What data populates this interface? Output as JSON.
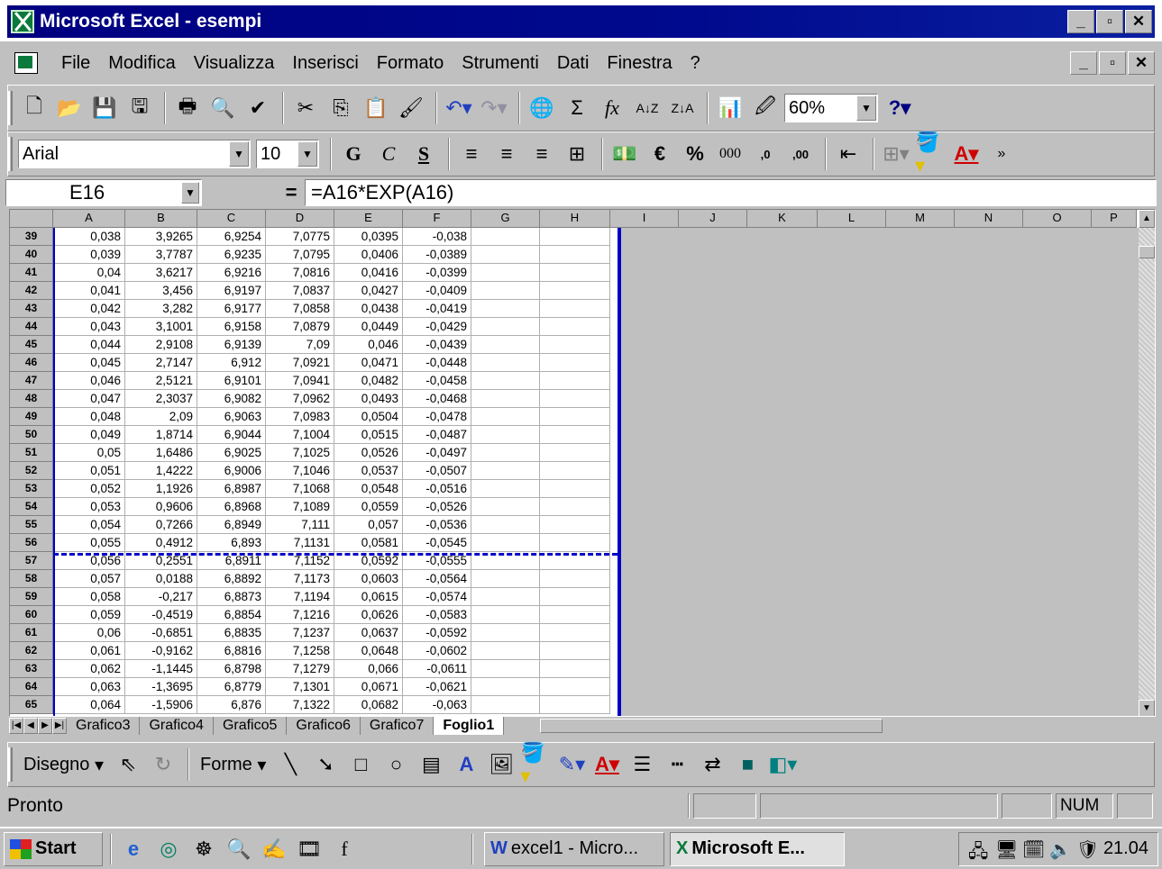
{
  "window": {
    "title": "Microsoft Excel - esempi"
  },
  "menu": [
    "File",
    "Modifica",
    "Visualizza",
    "Inserisci",
    "Formato",
    "Strumenti",
    "Dati",
    "Finestra",
    "?"
  ],
  "standard_toolbar": {
    "zoom": "60%"
  },
  "format_toolbar": {
    "font": "Arial",
    "size": "10",
    "bold": "G",
    "italic": "C",
    "underline": "S",
    "euro": "€",
    "percent": "%",
    "thousands": "000",
    "inc_decimals": ",0",
    "dec_decimals": ",00"
  },
  "formula_bar": {
    "cell_ref": "E16",
    "eq": "=",
    "formula": "=A16*EXP(A16)"
  },
  "columns": [
    "A",
    "B",
    "C",
    "D",
    "E",
    "F",
    "G",
    "H",
    "I",
    "J",
    "K",
    "L",
    "M",
    "N",
    "O",
    "P"
  ],
  "rows": [
    {
      "n": "39",
      "a": "0,038",
      "b": "3,9265",
      "c": "6,9254",
      "d": "7,0775",
      "e": "0,0395",
      "f": "-0,038"
    },
    {
      "n": "40",
      "a": "0,039",
      "b": "3,7787",
      "c": "6,9235",
      "d": "7,0795",
      "e": "0,0406",
      "f": "-0,0389"
    },
    {
      "n": "41",
      "a": "0,04",
      "b": "3,6217",
      "c": "6,9216",
      "d": "7,0816",
      "e": "0,0416",
      "f": "-0,0399"
    },
    {
      "n": "42",
      "a": "0,041",
      "b": "3,456",
      "c": "6,9197",
      "d": "7,0837",
      "e": "0,0427",
      "f": "-0,0409"
    },
    {
      "n": "43",
      "a": "0,042",
      "b": "3,282",
      "c": "6,9177",
      "d": "7,0858",
      "e": "0,0438",
      "f": "-0,0419"
    },
    {
      "n": "44",
      "a": "0,043",
      "b": "3,1001",
      "c": "6,9158",
      "d": "7,0879",
      "e": "0,0449",
      "f": "-0,0429"
    },
    {
      "n": "45",
      "a": "0,044",
      "b": "2,9108",
      "c": "6,9139",
      "d": "7,09",
      "e": "0,046",
      "f": "-0,0439"
    },
    {
      "n": "46",
      "a": "0,045",
      "b": "2,7147",
      "c": "6,912",
      "d": "7,0921",
      "e": "0,0471",
      "f": "-0,0448"
    },
    {
      "n": "47",
      "a": "0,046",
      "b": "2,5121",
      "c": "6,9101",
      "d": "7,0941",
      "e": "0,0482",
      "f": "-0,0458"
    },
    {
      "n": "48",
      "a": "0,047",
      "b": "2,3037",
      "c": "6,9082",
      "d": "7,0962",
      "e": "0,0493",
      "f": "-0,0468"
    },
    {
      "n": "49",
      "a": "0,048",
      "b": "2,09",
      "c": "6,9063",
      "d": "7,0983",
      "e": "0,0504",
      "f": "-0,0478"
    },
    {
      "n": "50",
      "a": "0,049",
      "b": "1,8714",
      "c": "6,9044",
      "d": "7,1004",
      "e": "0,0515",
      "f": "-0,0487"
    },
    {
      "n": "51",
      "a": "0,05",
      "b": "1,6486",
      "c": "6,9025",
      "d": "7,1025",
      "e": "0,0526",
      "f": "-0,0497"
    },
    {
      "n": "52",
      "a": "0,051",
      "b": "1,4222",
      "c": "6,9006",
      "d": "7,1046",
      "e": "0,0537",
      "f": "-0,0507"
    },
    {
      "n": "53",
      "a": "0,052",
      "b": "1,1926",
      "c": "6,8987",
      "d": "7,1068",
      "e": "0,0548",
      "f": "-0,0516"
    },
    {
      "n": "54",
      "a": "0,053",
      "b": "0,9606",
      "c": "6,8968",
      "d": "7,1089",
      "e": "0,0559",
      "f": "-0,0526"
    },
    {
      "n": "55",
      "a": "0,054",
      "b": "0,7266",
      "c": "6,8949",
      "d": "7,111",
      "e": "0,057",
      "f": "-0,0536"
    },
    {
      "n": "56",
      "a": "0,055",
      "b": "0,4912",
      "c": "6,893",
      "d": "7,1131",
      "e": "0,0581",
      "f": "-0,0545"
    },
    {
      "n": "57",
      "a": "0,056",
      "b": "0,2551",
      "c": "6,8911",
      "d": "7,1152",
      "e": "0,0592",
      "f": "-0,0555"
    },
    {
      "n": "58",
      "a": "0,057",
      "b": "0,0188",
      "c": "6,8892",
      "d": "7,1173",
      "e": "0,0603",
      "f": "-0,0564"
    },
    {
      "n": "59",
      "a": "0,058",
      "b": "-0,217",
      "c": "6,8873",
      "d": "7,1194",
      "e": "0,0615",
      "f": "-0,0574"
    },
    {
      "n": "60",
      "a": "0,059",
      "b": "-0,4519",
      "c": "6,8854",
      "d": "7,1216",
      "e": "0,0626",
      "f": "-0,0583"
    },
    {
      "n": "61",
      "a": "0,06",
      "b": "-0,6851",
      "c": "6,8835",
      "d": "7,1237",
      "e": "0,0637",
      "f": "-0,0592"
    },
    {
      "n": "62",
      "a": "0,061",
      "b": "-0,9162",
      "c": "6,8816",
      "d": "7,1258",
      "e": "0,0648",
      "f": "-0,0602"
    },
    {
      "n": "63",
      "a": "0,062",
      "b": "-1,1445",
      "c": "6,8798",
      "d": "7,1279",
      "e": "0,066",
      "f": "-0,0611"
    },
    {
      "n": "64",
      "a": "0,063",
      "b": "-1,3695",
      "c": "6,8779",
      "d": "7,1301",
      "e": "0,0671",
      "f": "-0,0621"
    },
    {
      "n": "65",
      "a": "0,064",
      "b": "-1,5906",
      "c": "6,876",
      "d": "7,1322",
      "e": "0,0682",
      "f": "-0,063"
    }
  ],
  "sheet_tabs": [
    "Grafico3",
    "Grafico4",
    "Grafico5",
    "Grafico6",
    "Grafico7",
    "Foglio1"
  ],
  "active_sheet": "Foglio1",
  "drawing_toolbar": {
    "draw": "Disegno",
    "shapes": "Forme"
  },
  "status": {
    "ready": "Pronto",
    "num": "NUM"
  },
  "taskbar": {
    "start": "Start",
    "tasks": [
      "excel1 - Micro...",
      "Microsoft E..."
    ],
    "clock": "21.04"
  },
  "colors": {
    "title_bar": "#000080",
    "page_break": "#0000c8",
    "face": "#c0c0c0"
  }
}
